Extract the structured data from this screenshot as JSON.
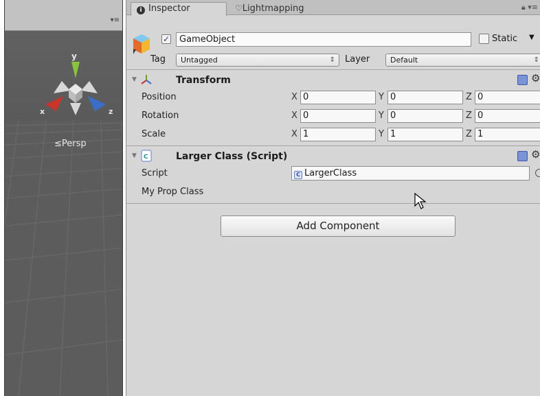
{
  "scene": {
    "menu_icon": "list-menu-icon",
    "gizmo": {
      "axis_y": "y",
      "axis_x": "x",
      "axis_z": "z"
    },
    "persp_label": "≤Persp"
  },
  "tabs": [
    {
      "label": "Inspector",
      "icon": "info-icon"
    },
    {
      "label": "Lightmapping",
      "icon": "lightbulb-icon"
    }
  ],
  "header": {
    "active": true,
    "name": "GameObject",
    "static_label": "Static",
    "static_checked": false,
    "tag_label": "Tag",
    "tag_value": "Untagged",
    "layer_label": "Layer",
    "layer_value": "Default"
  },
  "transform": {
    "title": "Transform",
    "rows": [
      {
        "label": "Position",
        "x": "0",
        "y": "0",
        "z": "0"
      },
      {
        "label": "Rotation",
        "x": "0",
        "y": "0",
        "z": "0"
      },
      {
        "label": "Scale",
        "x": "1",
        "y": "1",
        "z": "1"
      }
    ],
    "axis_labels": {
      "x": "X",
      "y": "Y",
      "z": "Z"
    }
  },
  "script_component": {
    "title": "Larger Class (Script)",
    "script_label": "Script",
    "script_value": "LargerClass",
    "prop_label": "My Prop Class"
  },
  "add_component_label": "Add Component",
  "colors": {
    "inspector_bg": "#d6d6d6",
    "scene_bg": "#5f5f5f",
    "gizmo_y": "#8ac33e",
    "gizmo_x": "#c8352a",
    "gizmo_z": "#3a6fc9"
  }
}
